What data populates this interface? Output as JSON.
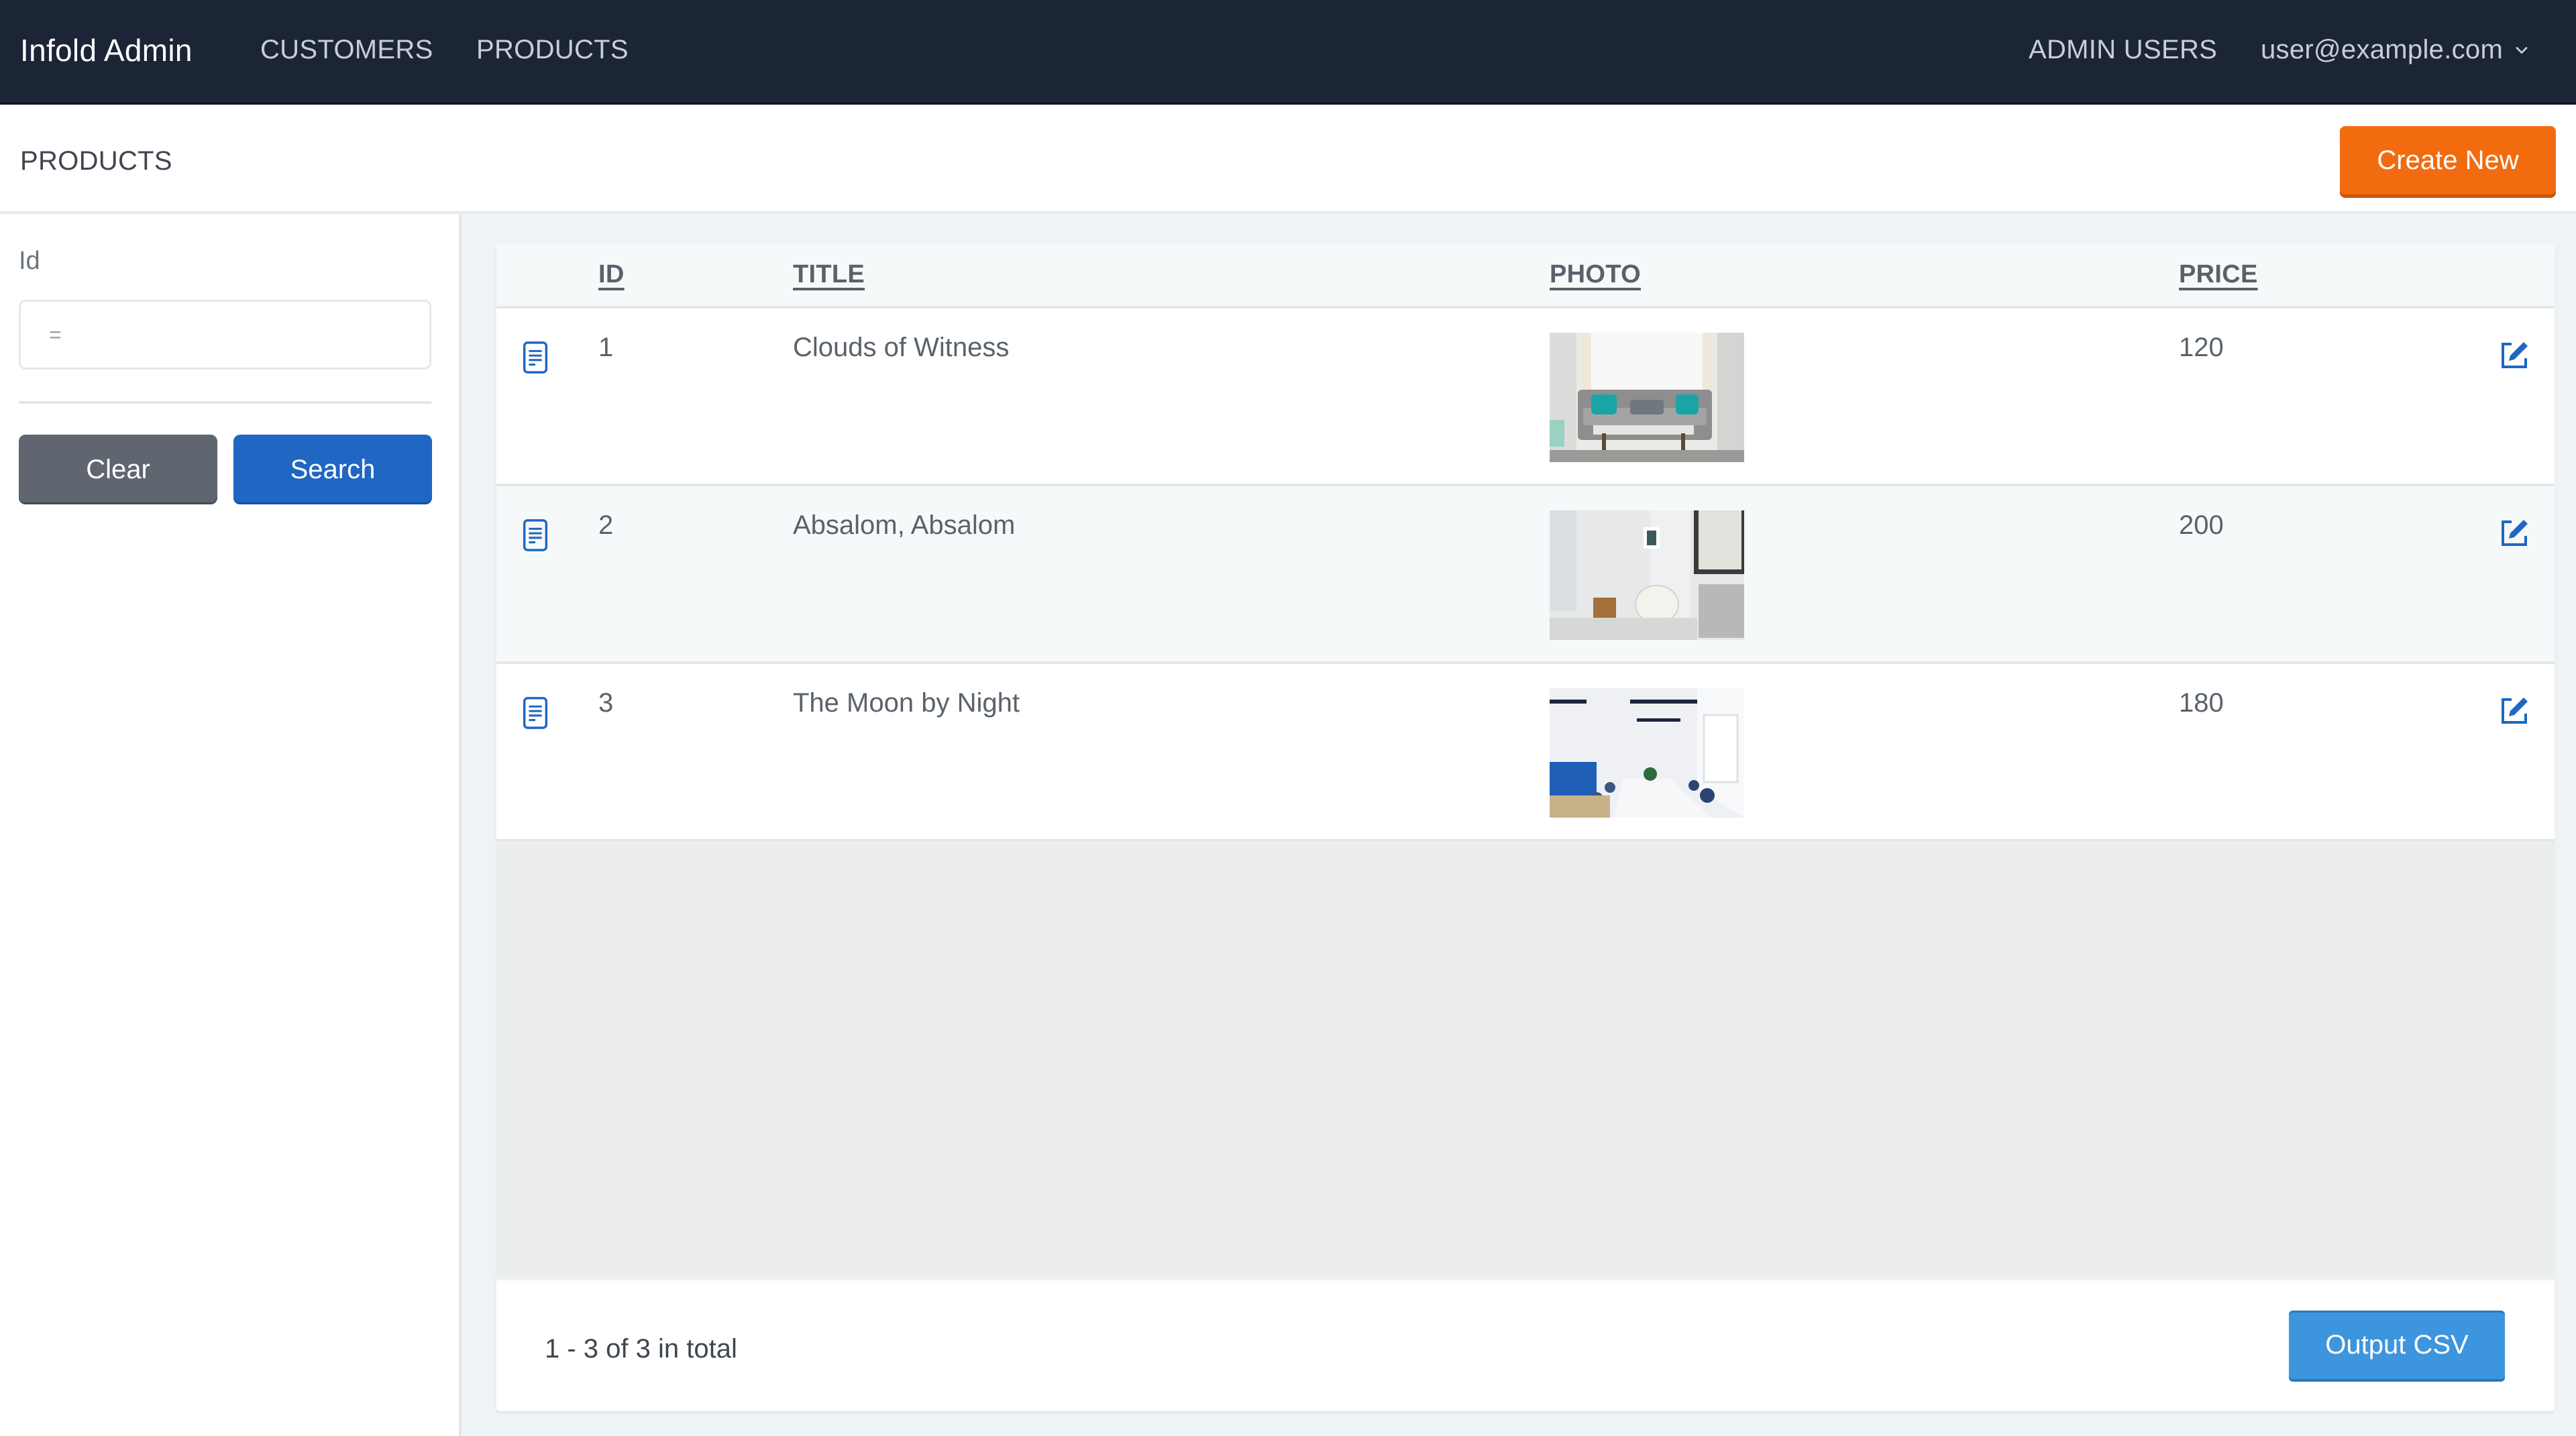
{
  "navbar": {
    "brand": "Infold Admin",
    "links": [
      "CUSTOMERS",
      "PRODUCTS"
    ],
    "admin_users": "ADMIN USERS",
    "user_email": "user@example.com",
    "user_menu_icon": "chevron-down-icon"
  },
  "page": {
    "title": "PRODUCTS",
    "create_button": "Create New"
  },
  "colors": {
    "navbar_bg": "#1c2536",
    "create_button": "#f26b0f",
    "search_button": "#1f67c2",
    "clear_button": "#5f6670",
    "csv_button": "#3d95dd",
    "icon_blue": "#1f67c2"
  },
  "filter": {
    "label": "Id",
    "input_value": "",
    "input_placeholder": "=",
    "clear_label": "Clear",
    "search_label": "Search"
  },
  "table": {
    "columns": [
      "ID",
      "TITLE",
      "PHOTO",
      "PRICE"
    ],
    "row_icons": {
      "show": "document-icon",
      "edit": "edit-icon"
    },
    "rows": [
      {
        "id": "1",
        "title": "Clouds of Witness",
        "photo": "living room with grey sofa and teal cushions",
        "price": "120"
      },
      {
        "id": "2",
        "title": "Absalom, Absalom",
        "photo": "white room with wicker chair and wooden stool",
        "price": "200"
      },
      {
        "id": "3",
        "title": "The Moon by Night",
        "photo": "bright meeting room with white table and blue sofa",
        "price": "180"
      }
    ]
  },
  "footer": {
    "pagination_info": "1 - 3 of 3 in total",
    "csv_button": "Output CSV"
  }
}
